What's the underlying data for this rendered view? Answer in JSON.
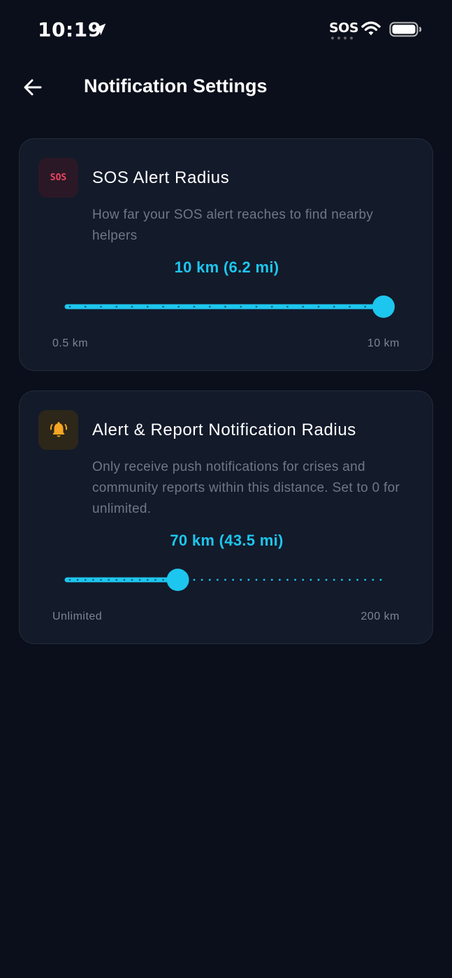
{
  "status_bar": {
    "time": "10:19",
    "carrier": "SOS"
  },
  "header": {
    "title": "Notification Settings"
  },
  "cards": [
    {
      "badge": "SOS",
      "title": "SOS Alert Radius",
      "description": "How far your SOS alert reaches to find nearby helpers",
      "value_label": "10 km (6.2 mi)",
      "slider": {
        "min": 0.5,
        "max": 10,
        "value": 10
      },
      "min_label": "0.5 km",
      "max_label": "10 km",
      "icon": "sos-icon",
      "accent": "#ef4561"
    },
    {
      "title": "Alert & Report Notification Radius",
      "description": "Only receive push notifications for crises and community reports within this distance. Set to 0 for unlimited.",
      "value_label": "70 km (43.5 mi)",
      "slider": {
        "min": 0,
        "max": 200,
        "value": 70
      },
      "min_label": "Unlimited",
      "max_label": "200 km",
      "icon": "bell-icon",
      "accent": "#f5a623"
    }
  ],
  "colors": {
    "background": "#0a0f1b",
    "card": "#131a2a",
    "accent": "#1dc6ee",
    "muted_text": "#6f7888"
  }
}
